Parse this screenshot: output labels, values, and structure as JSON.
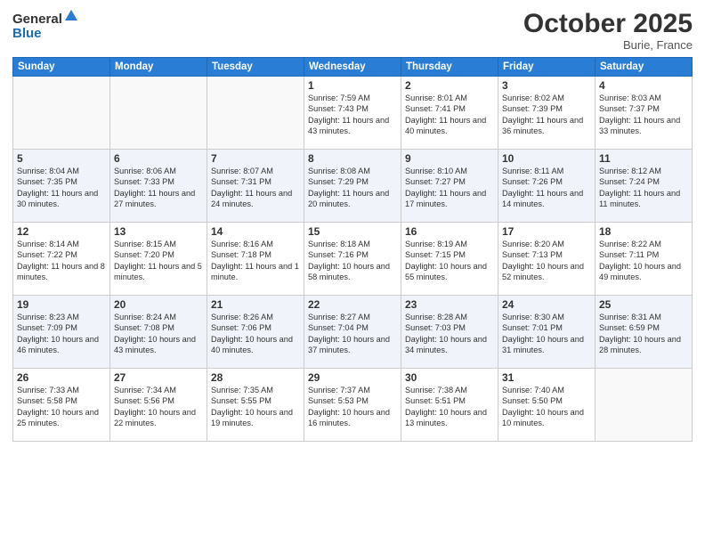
{
  "header": {
    "logo_general": "General",
    "logo_blue": "Blue",
    "month": "October 2025",
    "location": "Burie, France"
  },
  "weekdays": [
    "Sunday",
    "Monday",
    "Tuesday",
    "Wednesday",
    "Thursday",
    "Friday",
    "Saturday"
  ],
  "weeks": [
    [
      {
        "day": "",
        "info": ""
      },
      {
        "day": "",
        "info": ""
      },
      {
        "day": "",
        "info": ""
      },
      {
        "day": "1",
        "info": "Sunrise: 7:59 AM\nSunset: 7:43 PM\nDaylight: 11 hours\nand 43 minutes."
      },
      {
        "day": "2",
        "info": "Sunrise: 8:01 AM\nSunset: 7:41 PM\nDaylight: 11 hours\nand 40 minutes."
      },
      {
        "day": "3",
        "info": "Sunrise: 8:02 AM\nSunset: 7:39 PM\nDaylight: 11 hours\nand 36 minutes."
      },
      {
        "day": "4",
        "info": "Sunrise: 8:03 AM\nSunset: 7:37 PM\nDaylight: 11 hours\nand 33 minutes."
      }
    ],
    [
      {
        "day": "5",
        "info": "Sunrise: 8:04 AM\nSunset: 7:35 PM\nDaylight: 11 hours\nand 30 minutes."
      },
      {
        "day": "6",
        "info": "Sunrise: 8:06 AM\nSunset: 7:33 PM\nDaylight: 11 hours\nand 27 minutes."
      },
      {
        "day": "7",
        "info": "Sunrise: 8:07 AM\nSunset: 7:31 PM\nDaylight: 11 hours\nand 24 minutes."
      },
      {
        "day": "8",
        "info": "Sunrise: 8:08 AM\nSunset: 7:29 PM\nDaylight: 11 hours\nand 20 minutes."
      },
      {
        "day": "9",
        "info": "Sunrise: 8:10 AM\nSunset: 7:27 PM\nDaylight: 11 hours\nand 17 minutes."
      },
      {
        "day": "10",
        "info": "Sunrise: 8:11 AM\nSunset: 7:26 PM\nDaylight: 11 hours\nand 14 minutes."
      },
      {
        "day": "11",
        "info": "Sunrise: 8:12 AM\nSunset: 7:24 PM\nDaylight: 11 hours\nand 11 minutes."
      }
    ],
    [
      {
        "day": "12",
        "info": "Sunrise: 8:14 AM\nSunset: 7:22 PM\nDaylight: 11 hours\nand 8 minutes."
      },
      {
        "day": "13",
        "info": "Sunrise: 8:15 AM\nSunset: 7:20 PM\nDaylight: 11 hours\nand 5 minutes."
      },
      {
        "day": "14",
        "info": "Sunrise: 8:16 AM\nSunset: 7:18 PM\nDaylight: 11 hours\nand 1 minute."
      },
      {
        "day": "15",
        "info": "Sunrise: 8:18 AM\nSunset: 7:16 PM\nDaylight: 10 hours\nand 58 minutes."
      },
      {
        "day": "16",
        "info": "Sunrise: 8:19 AM\nSunset: 7:15 PM\nDaylight: 10 hours\nand 55 minutes."
      },
      {
        "day": "17",
        "info": "Sunrise: 8:20 AM\nSunset: 7:13 PM\nDaylight: 10 hours\nand 52 minutes."
      },
      {
        "day": "18",
        "info": "Sunrise: 8:22 AM\nSunset: 7:11 PM\nDaylight: 10 hours\nand 49 minutes."
      }
    ],
    [
      {
        "day": "19",
        "info": "Sunrise: 8:23 AM\nSunset: 7:09 PM\nDaylight: 10 hours\nand 46 minutes."
      },
      {
        "day": "20",
        "info": "Sunrise: 8:24 AM\nSunset: 7:08 PM\nDaylight: 10 hours\nand 43 minutes."
      },
      {
        "day": "21",
        "info": "Sunrise: 8:26 AM\nSunset: 7:06 PM\nDaylight: 10 hours\nand 40 minutes."
      },
      {
        "day": "22",
        "info": "Sunrise: 8:27 AM\nSunset: 7:04 PM\nDaylight: 10 hours\nand 37 minutes."
      },
      {
        "day": "23",
        "info": "Sunrise: 8:28 AM\nSunset: 7:03 PM\nDaylight: 10 hours\nand 34 minutes."
      },
      {
        "day": "24",
        "info": "Sunrise: 8:30 AM\nSunset: 7:01 PM\nDaylight: 10 hours\nand 31 minutes."
      },
      {
        "day": "25",
        "info": "Sunrise: 8:31 AM\nSunset: 6:59 PM\nDaylight: 10 hours\nand 28 minutes."
      }
    ],
    [
      {
        "day": "26",
        "info": "Sunrise: 7:33 AM\nSunset: 5:58 PM\nDaylight: 10 hours\nand 25 minutes."
      },
      {
        "day": "27",
        "info": "Sunrise: 7:34 AM\nSunset: 5:56 PM\nDaylight: 10 hours\nand 22 minutes."
      },
      {
        "day": "28",
        "info": "Sunrise: 7:35 AM\nSunset: 5:55 PM\nDaylight: 10 hours\nand 19 minutes."
      },
      {
        "day": "29",
        "info": "Sunrise: 7:37 AM\nSunset: 5:53 PM\nDaylight: 10 hours\nand 16 minutes."
      },
      {
        "day": "30",
        "info": "Sunrise: 7:38 AM\nSunset: 5:51 PM\nDaylight: 10 hours\nand 13 minutes."
      },
      {
        "day": "31",
        "info": "Sunrise: 7:40 AM\nSunset: 5:50 PM\nDaylight: 10 hours\nand 10 minutes."
      },
      {
        "day": "",
        "info": ""
      }
    ]
  ]
}
